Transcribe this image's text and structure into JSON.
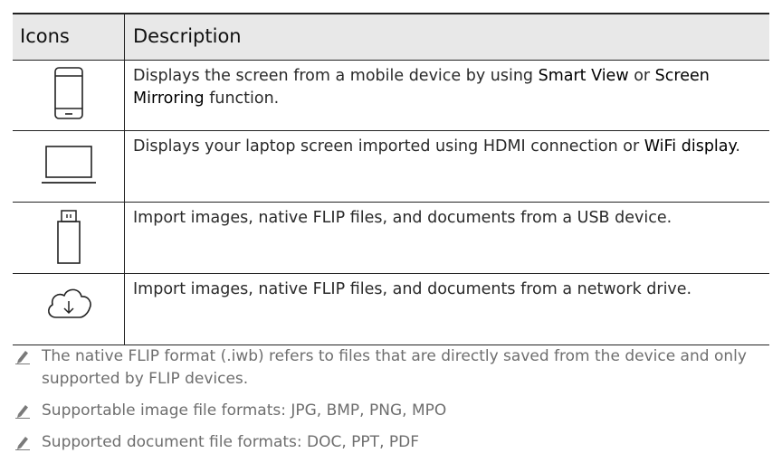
{
  "table": {
    "headers": {
      "icons": "Icons",
      "description": "Description"
    },
    "rows": [
      {
        "icon": "mobile-device-icon",
        "text_a": "Displays the screen from a mobile device by using ",
        "bold_a": "Smart View",
        "text_b": " or ",
        "bold_b": "Screen Mirroring",
        "text_c": " function."
      },
      {
        "icon": "laptop-icon",
        "text_a": "Displays your laptop screen imported using HDMI connection or ",
        "bold_a": "WiFi display",
        "text_b": "."
      },
      {
        "icon": "usb-device-icon",
        "text_a": "Import images, native FLIP files, and documents from a USB device."
      },
      {
        "icon": "network-drive-download-icon",
        "text_a": "Import images, native FLIP files, and documents from a network drive."
      }
    ]
  },
  "notes": [
    {
      "icon": "pencil-note-icon",
      "text": "The native FLIP format (.iwb) refers to files that are directly saved from the device and only supported by FLIP devices."
    },
    {
      "icon": "pencil-note-icon",
      "text": "Supportable image file formats: JPG, BMP, PNG, MPO"
    },
    {
      "icon": "pencil-note-icon",
      "text": "Supported document file formats: DOC, PPT, PDF"
    }
  ]
}
